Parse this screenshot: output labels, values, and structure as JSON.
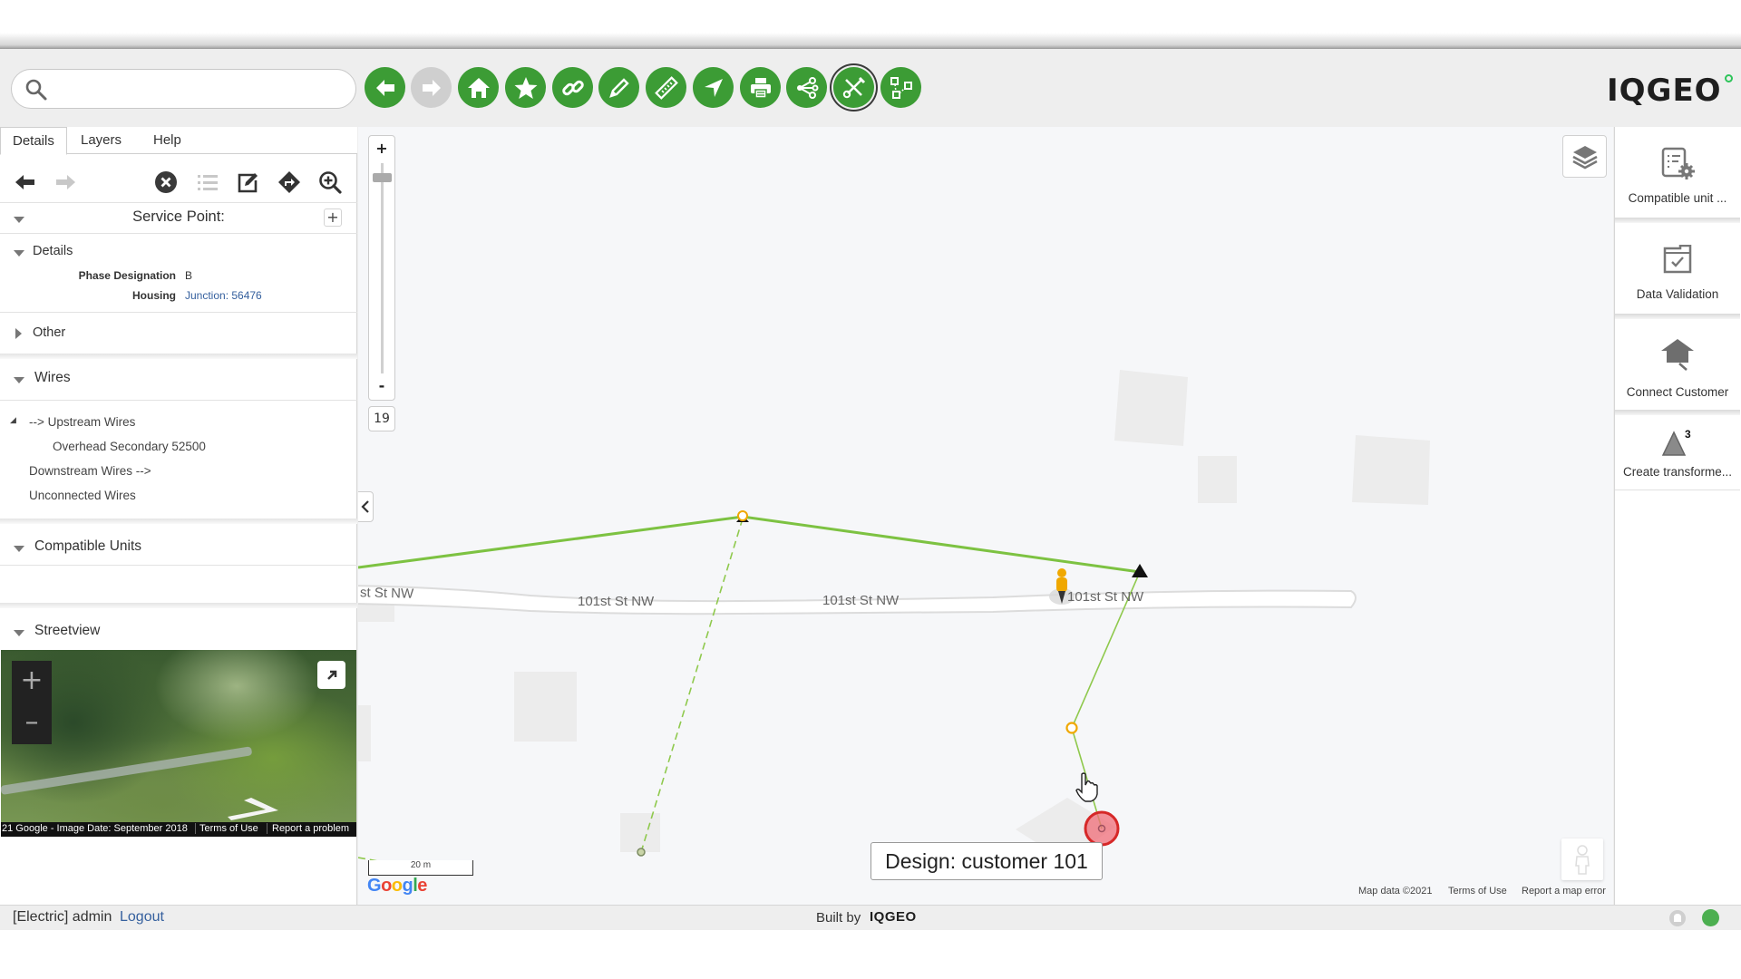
{
  "toolbar": {
    "search": {
      "placeholder": "",
      "value": ""
    },
    "buttons": [
      {
        "name": "back",
        "icon": "arrow-left-icon",
        "enabled": true
      },
      {
        "name": "forward",
        "icon": "arrow-right-icon",
        "enabled": false
      },
      {
        "name": "home",
        "icon": "home-icon",
        "enabled": true
      },
      {
        "name": "bookmarks",
        "icon": "star-icon",
        "enabled": true
      },
      {
        "name": "link",
        "icon": "link-icon",
        "enabled": true
      },
      {
        "name": "markup",
        "icon": "pencil-icon",
        "enabled": true
      },
      {
        "name": "measure",
        "icon": "ruler-icon",
        "enabled": true
      },
      {
        "name": "locate",
        "icon": "navigate-icon",
        "enabled": true
      },
      {
        "name": "print",
        "icon": "printer-icon",
        "enabled": true
      },
      {
        "name": "trace",
        "icon": "share-nodes-icon",
        "enabled": true
      },
      {
        "name": "tools",
        "icon": "tools-icon",
        "enabled": true,
        "active": true
      },
      {
        "name": "network",
        "icon": "network-icon",
        "enabled": true
      }
    ],
    "logo": "IQGEO"
  },
  "left_panel": {
    "tabs": [
      {
        "label": "Details",
        "active": true
      },
      {
        "label": "Layers",
        "active": false
      },
      {
        "label": "Help",
        "active": false
      }
    ],
    "feature_title": "Service Point:",
    "details_section": {
      "label": "Details",
      "fields": [
        {
          "label": "Phase Designation",
          "value": "B",
          "link": false
        },
        {
          "label": "Housing",
          "value": "Junction: 56476",
          "link": true
        }
      ]
    },
    "other_section": {
      "label": "Other"
    },
    "wires_section": {
      "label": "Wires",
      "items": [
        {
          "label": "--> Upstream Wires",
          "expanded": true,
          "children": [
            "Overhead Secondary 52500"
          ]
        },
        {
          "label": "Downstream Wires -->"
        },
        {
          "label": "Unconnected Wires"
        }
      ]
    },
    "compatible_units_section": {
      "label": "Compatible Units"
    },
    "streetview_section": {
      "label": "Streetview",
      "attribution": "21 Google - Image Date: September 2018",
      "terms": "Terms of Use",
      "report": "Report a problem",
      "google": "Google"
    }
  },
  "map": {
    "zoom_in": "+",
    "zoom_out": "-",
    "zoom_level": "19",
    "zoom_slider_fraction": 0.95,
    "street_labels": [
      "st St NW",
      "101st St NW",
      "101st St NW",
      "101st St NW"
    ],
    "design_label": "Design: customer 101",
    "scale_label": "20 m",
    "google_logo": "Google",
    "footer": {
      "map_data": "Map data ©2021",
      "terms": "Terms of Use",
      "report": "Report a map error"
    },
    "colors": {
      "wire": "#7dc242",
      "pole": "#f0a800",
      "service_point": "#e53935"
    }
  },
  "right_panel": {
    "items": [
      {
        "label": "Compatible unit ...",
        "icon": "compatible-unit-icon"
      },
      {
        "label": "Data Validation",
        "icon": "data-validation-icon"
      },
      {
        "label": "Connect Customer",
        "icon": "connect-customer-icon"
      },
      {
        "label": "Create transforme...",
        "icon": "create-transformer-icon",
        "badge": "3"
      }
    ]
  },
  "footer": {
    "user_prefix": "[Electric] admin",
    "logout": "Logout",
    "built_by": "Built by",
    "built_by_logo": "IQGEO",
    "status_color": "#4caf50"
  }
}
